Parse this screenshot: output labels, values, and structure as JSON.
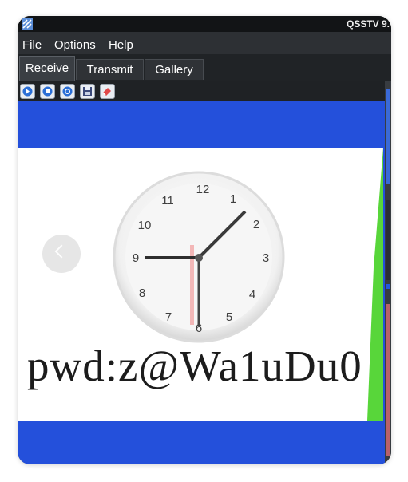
{
  "window": {
    "title": "QSSTV 9."
  },
  "menu": {
    "items": [
      "File",
      "Options",
      "Help"
    ]
  },
  "tabs": [
    {
      "label": "Receive",
      "active": true
    },
    {
      "label": "Transmit",
      "active": false
    },
    {
      "label": "Gallery",
      "active": false
    }
  ],
  "toolbar": {
    "buttons": [
      "play-icon",
      "stop-icon",
      "refresh-icon",
      "save-icon",
      "erase-icon"
    ]
  },
  "received_image": {
    "text": "pwd:z@Wa1uDu0",
    "clock_numbers": [
      "12",
      "1",
      "2",
      "3",
      "4",
      "5",
      "6",
      "7",
      "8",
      "9",
      "10",
      "11"
    ]
  },
  "colors": {
    "image_background": "#2450db",
    "side_level": "#58d63a"
  }
}
